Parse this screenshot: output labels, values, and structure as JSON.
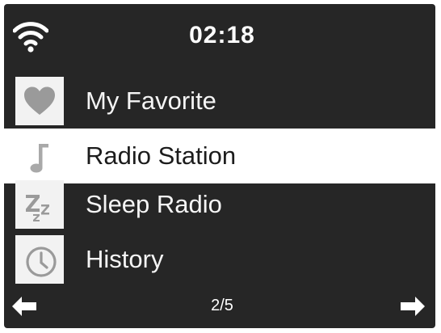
{
  "status": {
    "wifi_icon": "wifi-icon",
    "time": "02:18"
  },
  "menu": {
    "items": [
      {
        "label": "My Favorite",
        "icon": "heart-icon",
        "selected": false
      },
      {
        "label": "Radio Station",
        "icon": "music-note-icon",
        "selected": true
      },
      {
        "label": "Sleep Radio",
        "icon": "sleep-zzz-icon",
        "selected": false
      },
      {
        "label": "History",
        "icon": "clock-icon",
        "selected": false
      }
    ]
  },
  "footer": {
    "page": "2/5",
    "prev_icon": "arrow-left-icon",
    "next_icon": "arrow-right-icon"
  },
  "colors": {
    "background": "#262626",
    "selected_background": "#ffffff",
    "text": "#f5f5f5",
    "selected_text": "#1c1c1c",
    "icon_gray": "#9a9a9a"
  }
}
